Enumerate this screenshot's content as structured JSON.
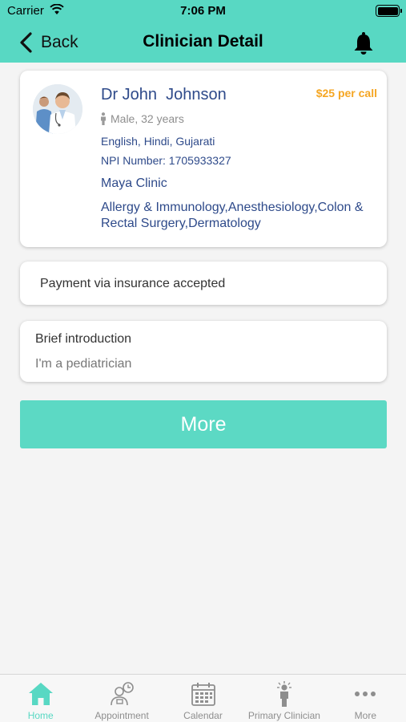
{
  "status_bar": {
    "carrier": "Carrier",
    "time": "7:06 PM"
  },
  "nav": {
    "back_label": "Back",
    "title": "Clinician Detail"
  },
  "doctor": {
    "name": "Dr John  Johnson",
    "price": "$25 per call",
    "gender_age": "Male, 32 years",
    "languages": "English, Hindi, Gujarati",
    "npi": "NPI Number: 1705933327",
    "clinic": "Maya Clinic",
    "specialties": "Allergy & Immunology,Anesthesiology,Colon & Rectal Surgery,Dermatology"
  },
  "payment": {
    "text": "Payment via insurance accepted"
  },
  "intro": {
    "heading": "Brief introduction",
    "body": "I'm a pediatrician"
  },
  "more_button": {
    "label": "More"
  },
  "tabs": [
    {
      "label": "Home",
      "icon": "home-icon",
      "active": true
    },
    {
      "label": "Appointment",
      "icon": "appointment-icon",
      "active": false
    },
    {
      "label": "Calendar",
      "icon": "calendar-icon",
      "active": false
    },
    {
      "label": "Primary Clinician",
      "icon": "primary-clinician-icon",
      "active": false
    },
    {
      "label": "More",
      "icon": "more-dots-icon",
      "active": false
    }
  ],
  "colors": {
    "accent": "#58d8c3",
    "name_blue": "#2e4a8a",
    "price_orange": "#f5a623"
  }
}
